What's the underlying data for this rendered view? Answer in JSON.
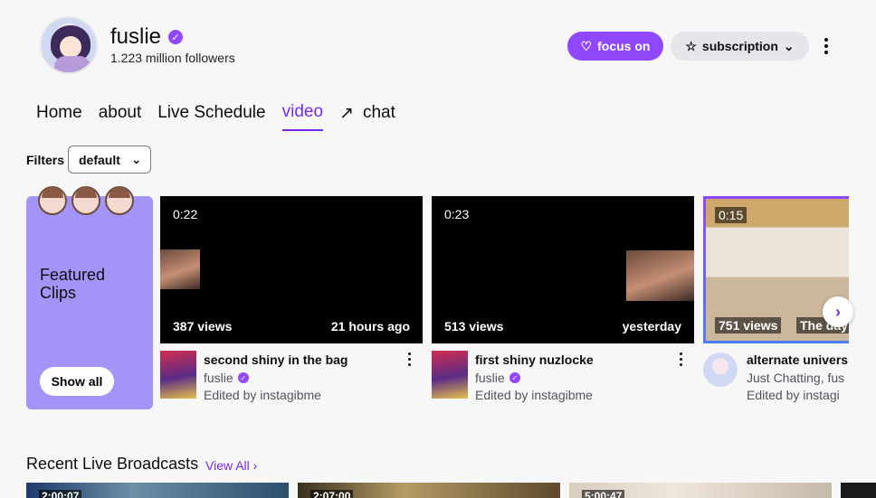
{
  "channel": {
    "name": "fuslie",
    "followers": "1.223 million followers"
  },
  "actions": {
    "focus_label": "focus on",
    "subscription_label": "subscription"
  },
  "tabs": [
    {
      "label": "Home"
    },
    {
      "label": "about"
    },
    {
      "label": "Live Schedule"
    },
    {
      "label": "video",
      "active": true
    },
    {
      "label": "chat"
    }
  ],
  "filters": {
    "label": "Filters",
    "selected": "default"
  },
  "featured": {
    "title": "Featured Clips",
    "show_all": "Show all"
  },
  "clips": [
    {
      "duration": "0:22",
      "views": "387 views",
      "ago": "21 hours ago",
      "title": "second shiny in the bag",
      "channel": "fuslie",
      "edited_by": "Edited by instagibme"
    },
    {
      "duration": "0:23",
      "views": "513 views",
      "ago": "yesterday",
      "title": "first shiny nuzlocke",
      "channel": "fuslie",
      "edited_by": "Edited by instagibme"
    },
    {
      "duration": "0:15",
      "views": "751 views",
      "ago": "The day",
      "title": "alternate univers",
      "category": "Just Chatting, fus",
      "edited_by": "Edited by instagi"
    }
  ],
  "recent": {
    "title": "Recent Live Broadcasts",
    "view_all": "View All",
    "durations": [
      "2:00:07",
      "2:07:00",
      "5:00:47"
    ]
  },
  "colors": {
    "accent": "#9147ff",
    "accent_text": "#772ce8",
    "featured_bg": "#a394f7"
  }
}
